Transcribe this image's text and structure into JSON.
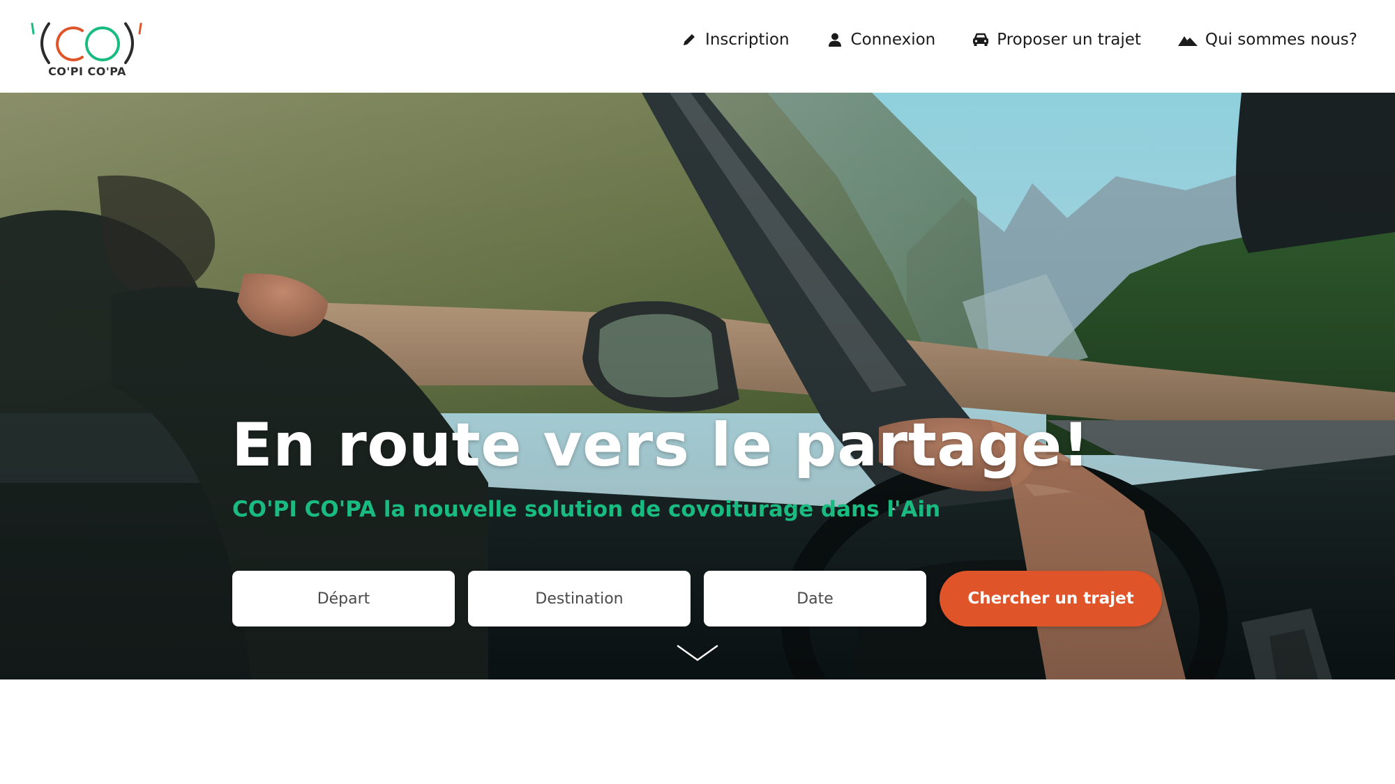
{
  "brand": {
    "logo_mark": "'(CO)'",
    "name": "CO'PI CO'PA",
    "colors": {
      "bracket_dark": "#2b2b2b",
      "green": "#19bb80",
      "orange": "#e0542a"
    }
  },
  "nav": {
    "items": [
      {
        "label": "Inscription",
        "icon": "pencil-icon"
      },
      {
        "label": "Connexion",
        "icon": "user-icon"
      },
      {
        "label": "Proposer un trajet",
        "icon": "car-icon"
      },
      {
        "label": "Qui sommes nous?",
        "icon": "mountain-icon"
      }
    ]
  },
  "hero": {
    "title": "En route vers le partage!",
    "subtitle": "CO'PI CO'PA la nouvelle solution de covoiturage dans l'Ain",
    "background": "driver-in-car-mountain-road-photo",
    "search": {
      "departure_placeholder": "Départ",
      "destination_placeholder": "Destination",
      "date_placeholder": "Date",
      "submit_label": "Chercher un trajet"
    },
    "scroll_icon": "chevron-down-icon"
  },
  "colors": {
    "accent": "#e0542a",
    "subtitle": "#19bb80",
    "nav_text": "#1b1b1b"
  }
}
